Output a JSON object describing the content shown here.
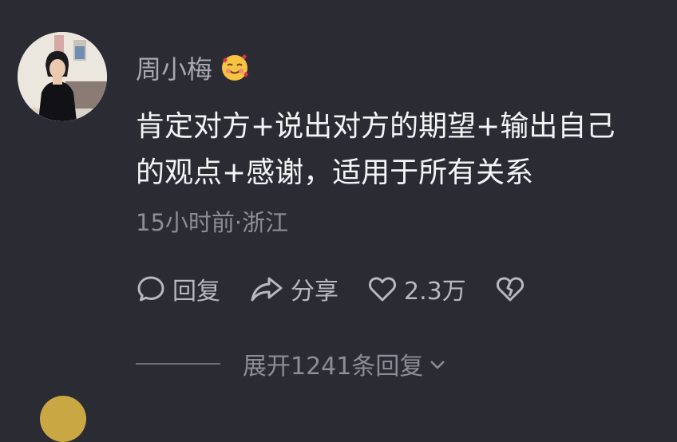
{
  "comment": {
    "username": "周小梅",
    "username_emoji": "smiling-face-with-hearts-icon",
    "text_line1": "肯定对方+说出对方的期望+输出自己",
    "text_line2": "的观点+感谢，适用于所有关系",
    "meta": "15小时前·浙江"
  },
  "actions": {
    "reply_label": "回复",
    "share_label": "分享",
    "like_count": "2.3万",
    "dislike_icon": "broken-heart-icon"
  },
  "expand": {
    "label": "展开1241条回复"
  },
  "colors": {
    "background": "#2b2b34",
    "text_primary": "#f4f4f6",
    "text_secondary": "#8d8d96"
  }
}
